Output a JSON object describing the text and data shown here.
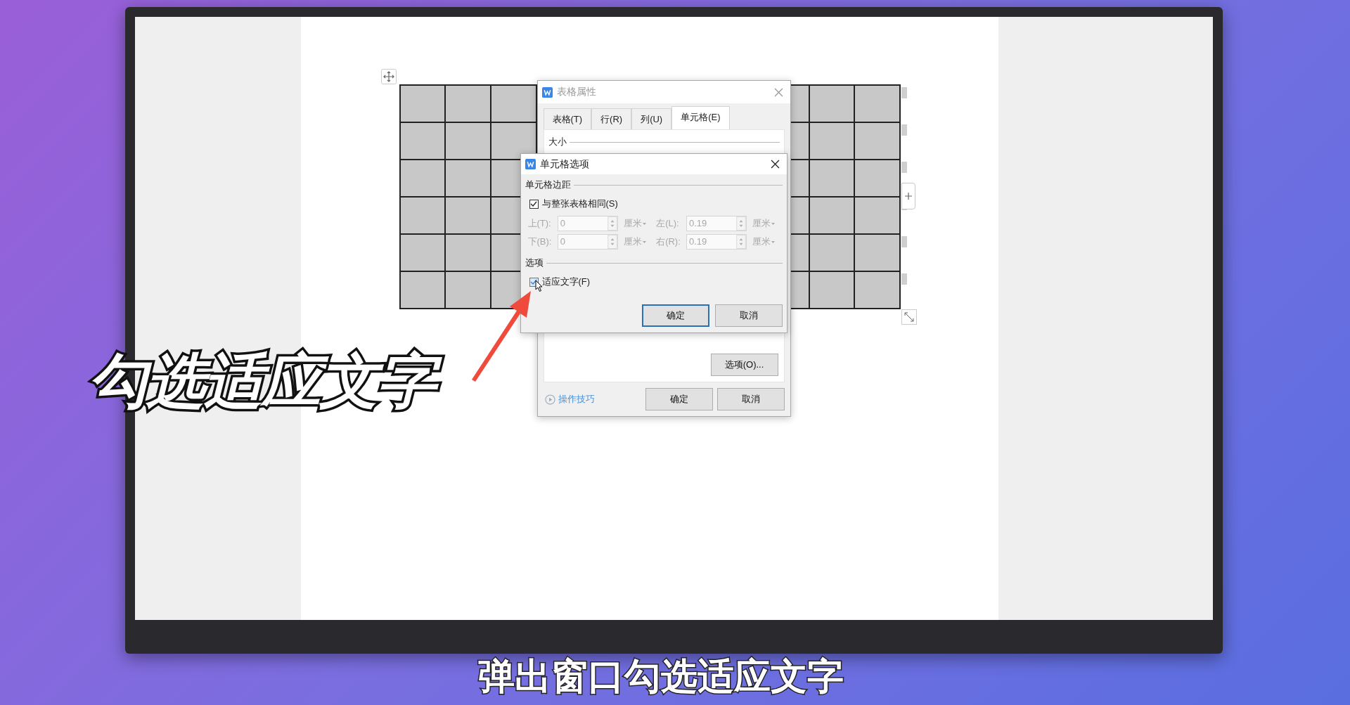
{
  "table_properties_dialog": {
    "title": "表格属性",
    "tabs": [
      {
        "label": "表格(T)",
        "selected": false
      },
      {
        "label": "行(R)",
        "selected": false
      },
      {
        "label": "列(U)",
        "selected": false
      },
      {
        "label": "单元格(E)",
        "selected": true
      }
    ],
    "size_section": "大小",
    "options_button": "选项(O)...",
    "tips_link": "操作技巧",
    "ok_button": "确定",
    "cancel_button": "取消"
  },
  "cell_options_dialog": {
    "title": "单元格选项",
    "margins_section": "单元格边距",
    "same_as_table": {
      "label": "与整张表格相同(S)",
      "checked": true
    },
    "margins": [
      {
        "label": "上(T):",
        "value": "0",
        "unit": "厘米",
        "disabled": true
      },
      {
        "label": "左(L):",
        "value": "0.19",
        "unit": "厘米",
        "disabled": true
      },
      {
        "label": "下(B):",
        "value": "0",
        "unit": "厘米",
        "disabled": true
      },
      {
        "label": "右(R):",
        "value": "0.19",
        "unit": "厘米",
        "disabled": true
      }
    ],
    "options_section": "选项",
    "fit_text": {
      "label": "适应文字(F)",
      "checked": true
    },
    "ok_button": "确定",
    "cancel_button": "取消"
  },
  "caption": "勾选适应文字",
  "subtitle": "弹出窗口勾选适应文字"
}
